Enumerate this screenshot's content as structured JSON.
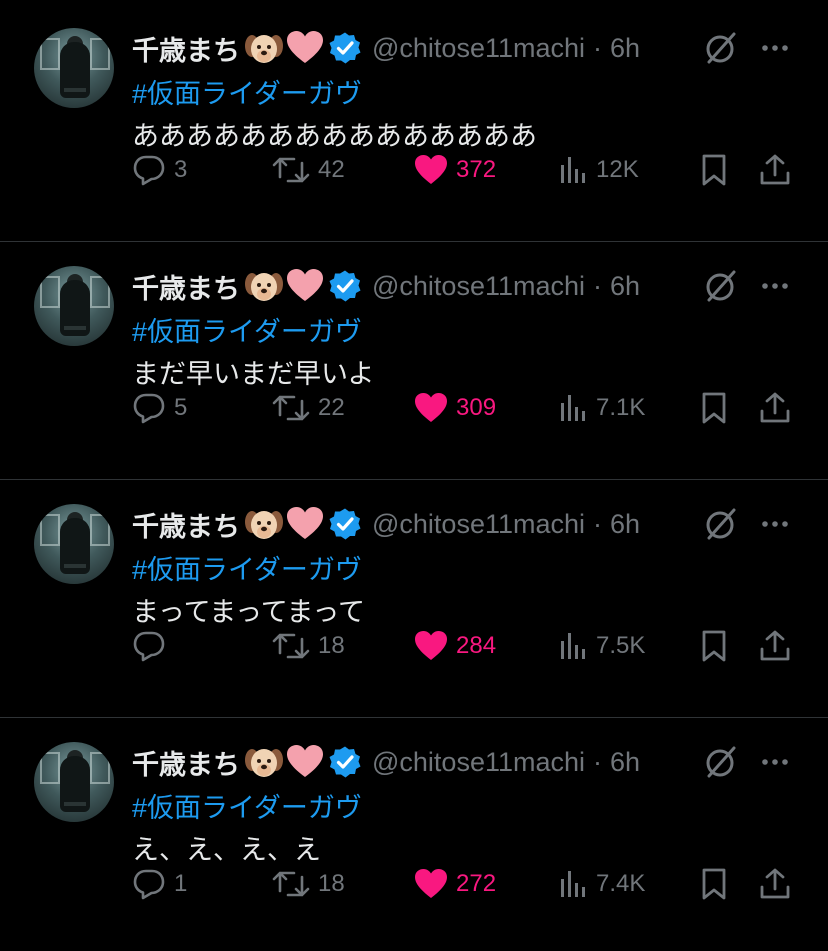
{
  "author": {
    "name": "千歳まち",
    "handle": "@chitose11machi",
    "separator": "·",
    "badges": [
      "dog-emoji-icon",
      "pink-heart-icon",
      "verified-badge-icon"
    ]
  },
  "colors": {
    "background": "#000000",
    "text": "#e7e9ea",
    "muted": "#71767b",
    "link": "#1d9bf0",
    "like": "#f91880",
    "verified": "#1d9bf0"
  },
  "tweets": [
    {
      "time": "6h",
      "hashtag": "#仮面ライダーガヴ",
      "text": "あああああああああああああああ",
      "replies": "3",
      "retweets": "42",
      "likes": "372",
      "views": "12K"
    },
    {
      "time": "6h",
      "hashtag": "#仮面ライダーガヴ",
      "text": "まだ早いまだ早いよ",
      "replies": "5",
      "retweets": "22",
      "likes": "309",
      "views": "7.1K"
    },
    {
      "time": "6h",
      "hashtag": "#仮面ライダーガヴ",
      "text": "まってまってまって",
      "replies": "",
      "retweets": "18",
      "likes": "284",
      "views": "7.5K"
    },
    {
      "time": "6h",
      "hashtag": "#仮面ライダーガヴ",
      "text": "え、え、え、え",
      "replies": "1",
      "retweets": "18",
      "likes": "272",
      "views": "7.4K"
    }
  ]
}
